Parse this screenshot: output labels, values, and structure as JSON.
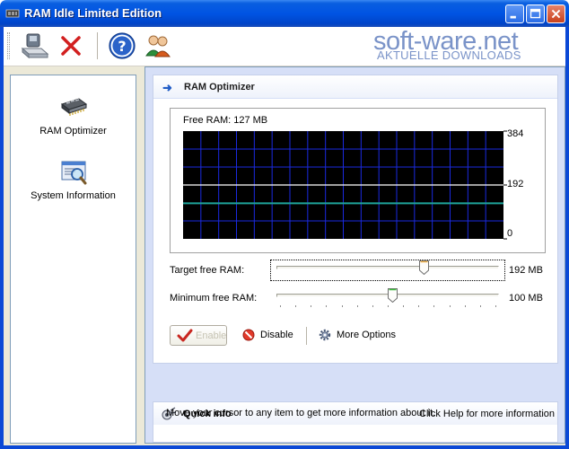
{
  "window": {
    "title": "RAM Idle Limited Edition"
  },
  "watermark": {
    "brand": "soft-ware.net",
    "subtitle": "AKTUELLE DOWNLOADS"
  },
  "toolbar": {
    "buttons": [
      "drive-settings-icon",
      "close-x-icon",
      "help-icon",
      "users-icon"
    ]
  },
  "sidebar": {
    "items": [
      {
        "label": "RAM Optimizer",
        "icon": "ram-chip-icon"
      },
      {
        "label": "System Information",
        "icon": "system-info-icon"
      }
    ]
  },
  "optimizer": {
    "header": "RAM Optimizer",
    "graph": {
      "free_ram_label": "Free RAM: 127 MB",
      "ticks": [
        "384",
        "192",
        "0"
      ],
      "free_ram_mb": 127,
      "target_line_mb": 192,
      "y_max": 384
    },
    "target": {
      "label": "Target free RAM:",
      "value": "192 MB",
      "position": 0.66
    },
    "minimum": {
      "label": "Minimum free RAM:",
      "value": "100 MB",
      "position": 0.52
    },
    "buttons": {
      "enable": "Enable",
      "disable": "Disable",
      "more_options": "More Options"
    }
  },
  "quick_info": {
    "title": "Quick info",
    "help_hint": "Click Help for more information",
    "message": "Move your cursor to any item to get more information about it."
  },
  "colors": {
    "title_bar": "#0054e3",
    "graph_bg": "#000000",
    "graph_grid": "#1a2ae0",
    "graph_line": "#1fa39a",
    "panel_bg": "#d6dff7"
  }
}
